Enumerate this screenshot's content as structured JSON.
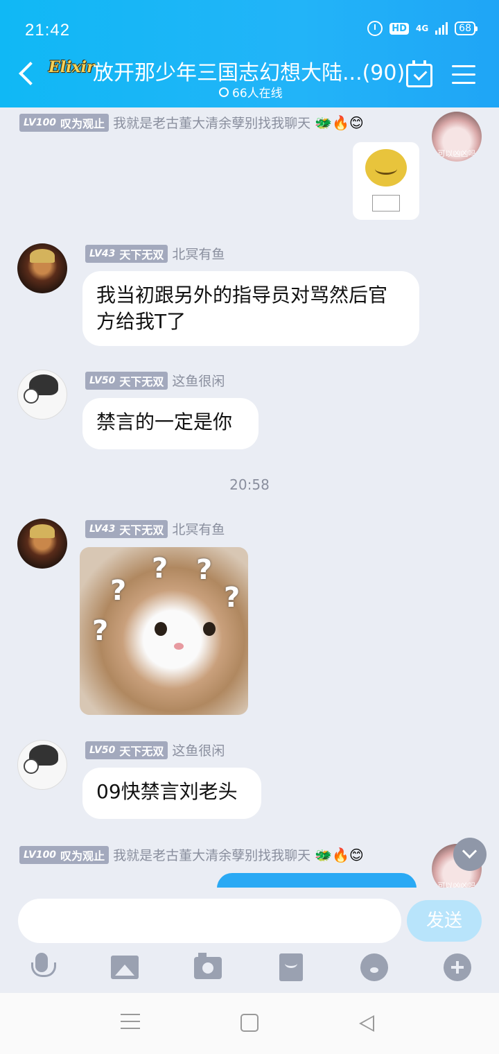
{
  "status_bar": {
    "time": "21:42",
    "hd": "HD",
    "network": "4G",
    "battery": "68"
  },
  "header": {
    "brand": "Elixir",
    "title": "放开那少年三国志幻想大陆...(90)",
    "online": "66人在线"
  },
  "messages": [
    {
      "level": "LV100",
      "title": "叹为观止",
      "nickname": "我就是老古董大清余孽别找我聊天",
      "emojis": "🐲🔥😊",
      "avatar_label": "可以凶凶吗",
      "type": "sticker"
    },
    {
      "level": "LV43",
      "title": "天下无双",
      "nickname": "北冥有鱼",
      "text": "我当初跟另外的指导员对骂然后官方给我T了"
    },
    {
      "level": "LV50",
      "title": "天下无双",
      "nickname": "这鱼很闲",
      "text": "禁言的一定是你"
    },
    {
      "timestamp": "20:58"
    },
    {
      "level": "LV43",
      "title": "天下无双",
      "nickname": "北冥有鱼",
      "type": "sticker",
      "sticker_marks": [
        "?",
        "?",
        "?",
        "?",
        "?"
      ]
    },
    {
      "level": "LV50",
      "title": "天下无双",
      "nickname": "这鱼很闲",
      "text": "09快禁言刘老头"
    },
    {
      "level": "LV100",
      "title": "叹为观止",
      "nickname": "我就是老古董大清余孽别找我聊天",
      "emojis": "🐲🔥😊",
      "avatar_label": "可以凶凶吗"
    }
  ],
  "input": {
    "value": "",
    "placeholder": "",
    "send_label": "发送"
  },
  "toolbar": [
    "mic-icon",
    "image-icon",
    "camera-icon",
    "red-packet-icon",
    "emoji-icon",
    "plus-icon"
  ],
  "colors": {
    "header": "#22b4f8",
    "background": "#eaedf4",
    "badge": "#a3a9bd",
    "send_disabled": "#b8e4fb"
  }
}
